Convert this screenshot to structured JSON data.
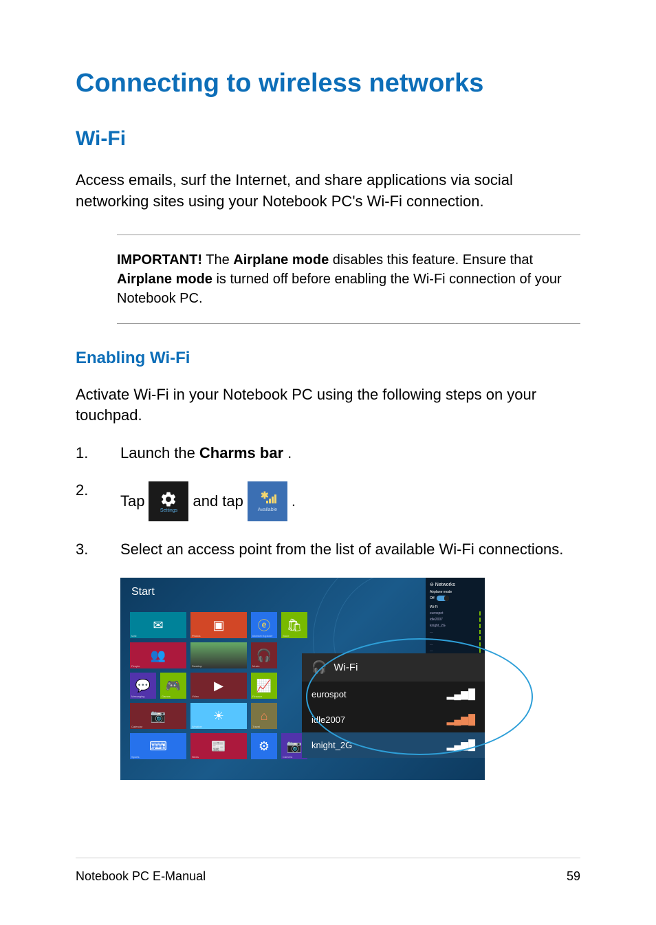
{
  "heading": "Connecting to wireless networks",
  "section1": {
    "title": "Wi-Fi",
    "intro": "Access emails, surf the Internet, and share applications via social networking sites using your Notebook PC's Wi-Fi connection."
  },
  "important": {
    "label": "IMPORTANT!",
    "pre": " The ",
    "term1": "Airplane mode",
    "mid": " disables this feature. Ensure that ",
    "term2": "Airplane mode",
    "post": " is turned off before enabling the Wi-Fi connection of your Notebook PC."
  },
  "section2": {
    "title": "Enabling Wi-Fi",
    "intro": "Activate Wi-Fi in your Notebook PC using the following steps on your touchpad."
  },
  "steps": {
    "s1": {
      "num": "1.",
      "pre": "Launch the ",
      "bold": "Charms bar",
      "post": "."
    },
    "s2": {
      "num": "2.",
      "pre": "Tap ",
      "mid": " and tap ",
      "post": ".",
      "settings_label": "Settings",
      "available_label": "Available"
    },
    "s3": {
      "num": "3.",
      "text": "Select an access point from the list of available Wi-Fi connections."
    }
  },
  "screenshot": {
    "start": "Start",
    "wifi_header": "Wi-Fi",
    "networks": {
      "title": "⊖ Networks",
      "airplane": "Airplane mode",
      "off": "Off",
      "wifi_label": "Wi-Fi",
      "items": [
        "eurospot",
        "idle2007",
        "knight_2G"
      ]
    },
    "tiles_labels": {
      "mail": "Mail",
      "people": "People",
      "messaging": "Messaging",
      "photos": "Photos",
      "desktop": "Desktop",
      "ie": "Internet Explorer",
      "video": "Video",
      "games": "Games",
      "store": "Store",
      "calendar": "Calendar",
      "music": "Music",
      "weather": "Weather",
      "sports": "Sports",
      "news": "News",
      "travel": "Travel",
      "camera": "Camera",
      "finance": "Finance"
    }
  },
  "footer": {
    "left": "Notebook PC E-Manual",
    "right": "59"
  }
}
